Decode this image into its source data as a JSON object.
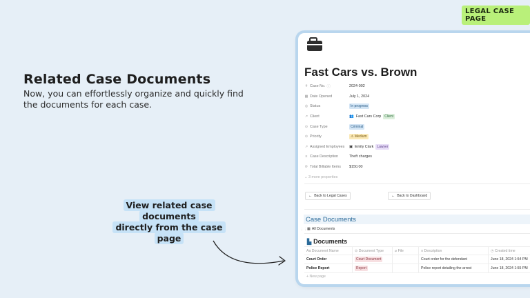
{
  "badge": "LEGAL CASE PAGE",
  "hero": {
    "title": "Related Case Documents",
    "subtitle": "Now, you can effortlessly organize and quickly find the documents for each case."
  },
  "callout": {
    "line1": "View related case documents",
    "line2": "directly from the case page"
  },
  "page": {
    "icon": "briefcase-icon",
    "title": "Fast Cars vs. Brown",
    "properties": [
      {
        "label": "Case No.",
        "icon": "hash-icon",
        "value": "2024-002"
      },
      {
        "label": "Date Opened",
        "icon": "calendar-icon",
        "value": "July 1, 2024"
      },
      {
        "label": "Status",
        "icon": "status-icon",
        "value": "In progress"
      },
      {
        "label": "Client",
        "icon": "relation-icon",
        "value": "Fast Cars Corp",
        "tag": "Client"
      },
      {
        "label": "Case Type",
        "icon": "select-icon",
        "value": "Criminal"
      },
      {
        "label": "Priority",
        "icon": "select-icon",
        "value": "Medium"
      },
      {
        "label": "Assigned Employees",
        "icon": "relation-icon",
        "value": "Emily Clark",
        "tag": "Lawyer"
      },
      {
        "label": "Case Description",
        "icon": "text-icon",
        "value": "Theft charges"
      },
      {
        "label": "Total Billable Items",
        "icon": "rollup-icon",
        "value": "$150.00"
      }
    ],
    "more_properties": "3 more properties",
    "back_legal": "Back to Legal Cases",
    "back_dashboard": "Back to Dashboard",
    "section_title": "Case Documents",
    "view_tab": "All Documents",
    "db_title": "Documents",
    "columns": [
      "Document Name",
      "Document Type",
      "File",
      "Description",
      "Created time"
    ],
    "rows": [
      {
        "name": "Court Order",
        "type": "Court Document",
        "file": "",
        "description": "Court order for the defendant",
        "created": "June 18, 2024 1:54 PM"
      },
      {
        "name": "Police Report",
        "type": "Report",
        "file": "",
        "description": "Police report detailing the arrest",
        "created": "June 18, 2024 1:55 PM"
      }
    ],
    "new_page": "New page"
  },
  "colors": {
    "background": "#e6eff7",
    "badge": "#b9f07a",
    "callout_highlight": "#c6e2f7",
    "section_heading": "#2a6a99"
  }
}
